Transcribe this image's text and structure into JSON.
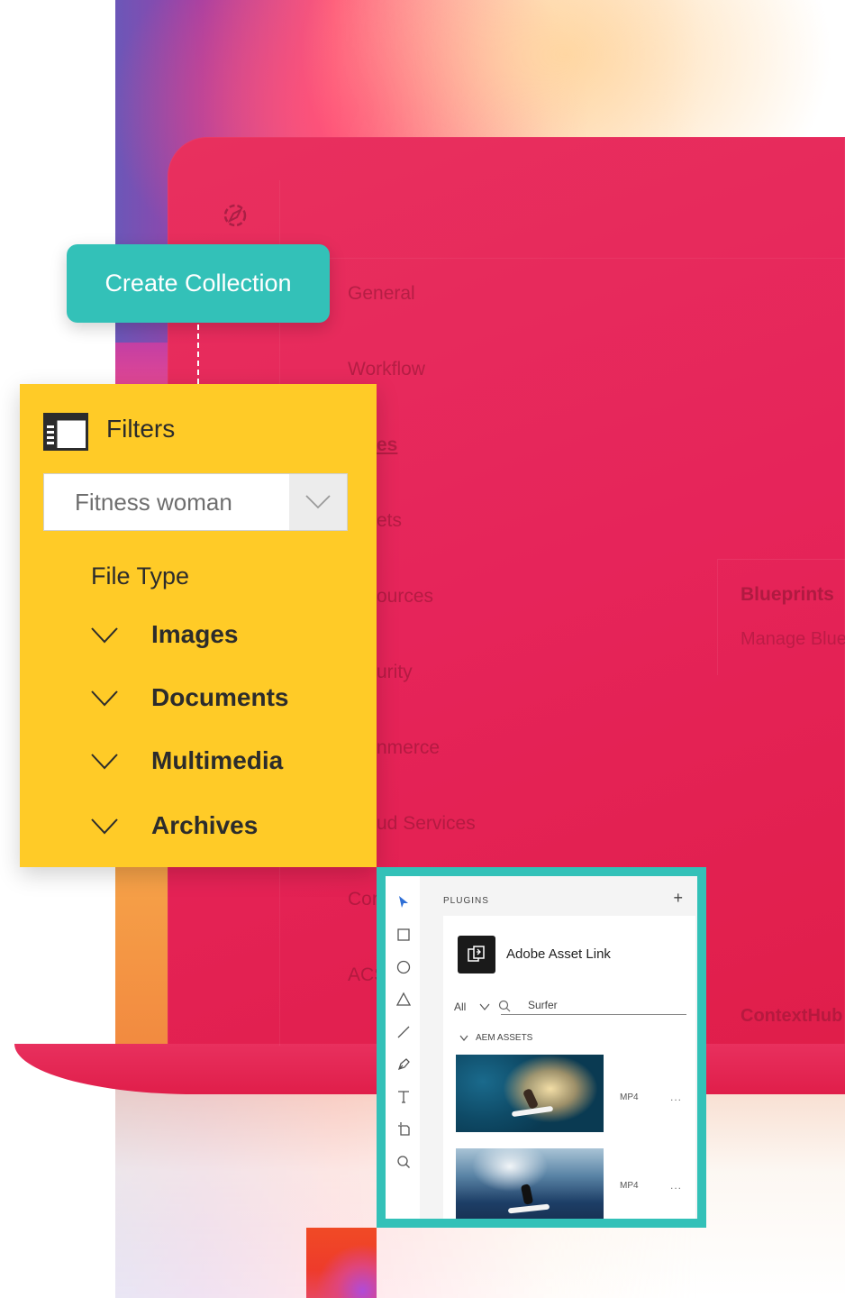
{
  "create_collection": {
    "label": "Create Collection"
  },
  "nav": {
    "items": [
      {
        "label": "General"
      },
      {
        "label": "Workflow"
      },
      {
        "label": "es"
      },
      {
        "label": "ets"
      },
      {
        "label": "ources"
      },
      {
        "label": "urity"
      },
      {
        "label": "nmerce"
      },
      {
        "label": "ud Services"
      },
      {
        "label": "Cor"
      },
      {
        "label": "ACS"
      }
    ]
  },
  "right_panel": {
    "title": "Blueprints",
    "subtitle": "Manage Bluep",
    "bottom": "ContextHub"
  },
  "filters": {
    "title": "Filters",
    "search_value": "Fitness woman",
    "file_type_label": "File Type",
    "options": [
      {
        "label": "Images"
      },
      {
        "label": "Documents"
      },
      {
        "label": "Multimedia"
      },
      {
        "label": "Archives"
      }
    ]
  },
  "plugin": {
    "header": "PLUGINS",
    "plus": "+",
    "asset_link_title": "Adobe Asset Link",
    "filter_all": "All",
    "search_value": "Surfer",
    "section": "AEM ASSETS",
    "assets": [
      {
        "type": "MP4",
        "more": "..."
      },
      {
        "type": "MP4",
        "more": "..."
      }
    ]
  },
  "colors": {
    "teal": "#33c1b8",
    "yellow": "#ffcb27",
    "crimson": "#e6245a"
  }
}
